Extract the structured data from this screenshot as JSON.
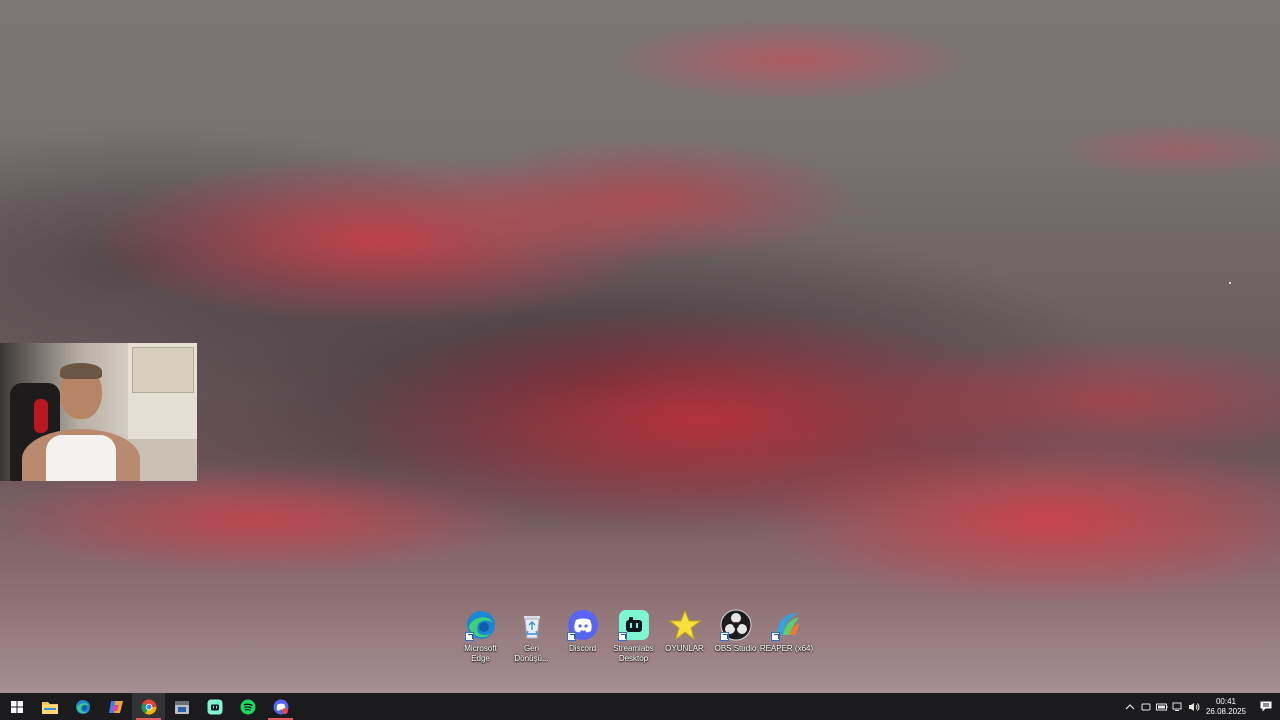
{
  "desktop": {
    "icons": [
      {
        "label": "Microsoft\nEdge",
        "icon": "edge-icon"
      },
      {
        "label": "Geri\nDönüşü...",
        "icon": "recycle-bin-icon"
      },
      {
        "label": "Discord",
        "icon": "discord-icon"
      },
      {
        "label": "Streamlabs\nDesktop",
        "icon": "streamlabs-icon"
      },
      {
        "label": "OYUNLAR",
        "icon": "star-folder-icon"
      },
      {
        "label": "OBS Studio",
        "icon": "obs-icon"
      },
      {
        "label": "REAPER (x64)",
        "icon": "reaper-icon"
      }
    ]
  },
  "taskbar": {
    "apps": [
      {
        "name": "start",
        "icon": "windows-icon"
      },
      {
        "name": "file-explorer",
        "icon": "folder-icon"
      },
      {
        "name": "edge",
        "icon": "edge-icon"
      },
      {
        "name": "copilot",
        "icon": "copilot-icon"
      },
      {
        "name": "chrome",
        "icon": "chrome-icon",
        "active": true
      },
      {
        "name": "app-calendar",
        "icon": "calendar-app-icon"
      },
      {
        "name": "streamlabs",
        "icon": "streamlabs-icon"
      },
      {
        "name": "spotify",
        "icon": "spotify-icon"
      },
      {
        "name": "discord",
        "icon": "discord-icon",
        "running": true
      }
    ],
    "clock": {
      "time": "00:41",
      "date": "26.08.2025"
    }
  },
  "colors": {
    "taskbar_bg": "#1b1a1d",
    "active_indicator": "#e35a5a",
    "sky_red": "#d64a58"
  }
}
